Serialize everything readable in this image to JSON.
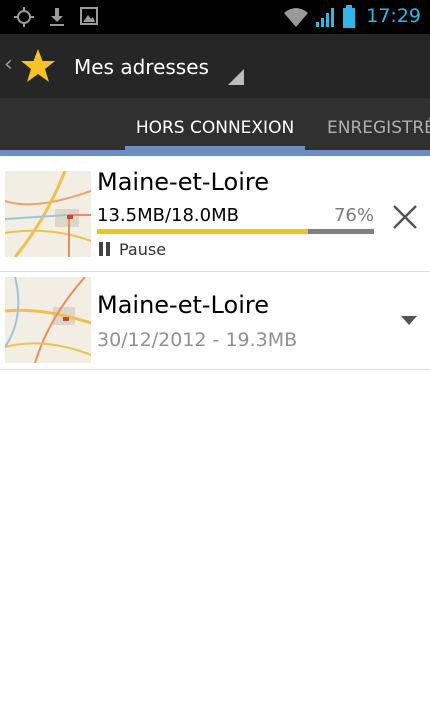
{
  "status_bar": {
    "time": "17:29",
    "icons": [
      "gps-icon",
      "download-icon",
      "image-icon",
      "wifi-icon",
      "signal-icon",
      "battery-icon"
    ],
    "accent_color": "#33b5e5"
  },
  "action_bar": {
    "title": "Mes adresses",
    "icon": "star-icon"
  },
  "tabs": [
    {
      "label": "HORS CONNEXION",
      "active": true
    },
    {
      "label": "ENREGISTRÉS",
      "active": false
    }
  ],
  "items": [
    {
      "title": "Maine-et-Loire",
      "status": "downloading",
      "size_text": "13.5MB/18.0MB",
      "percent_text": "76%",
      "progress": 0.76,
      "pause_label": "Pause",
      "action_icon": "close-icon"
    },
    {
      "title": "Maine-et-Loire",
      "status": "downloaded",
      "subtitle": "30/12/2012 - 19.3MB",
      "action_icon": "chevron-down-icon"
    }
  ],
  "colors": {
    "progress": "#f5c21b",
    "progress_track": "#808080",
    "tab_indicator": "#6b8ec6"
  }
}
